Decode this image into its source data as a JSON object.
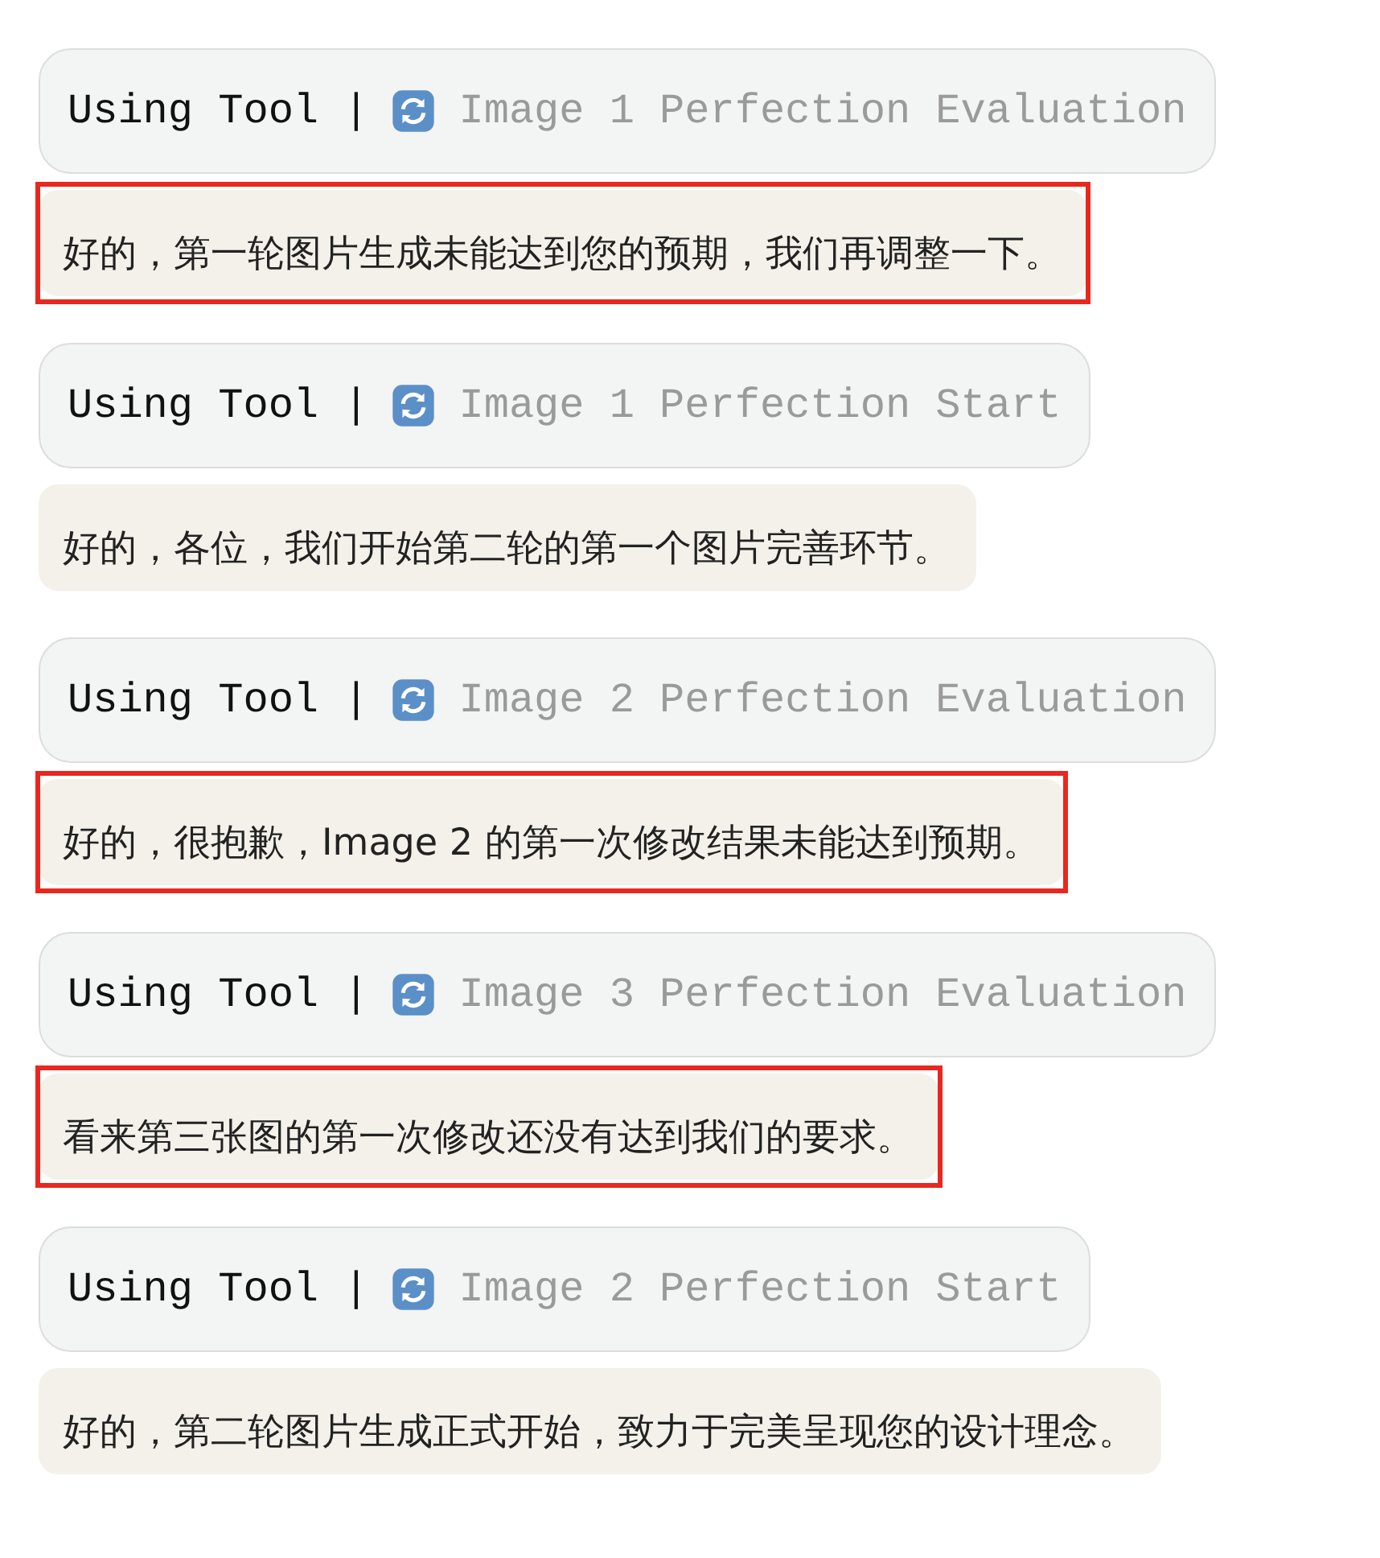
{
  "items": [
    {
      "kind": "tool",
      "prefix": "Using Tool |",
      "label": "Image 1 Perfection Evaluation"
    },
    {
      "kind": "message",
      "text": "好的，第一轮图片生成未能达到您的预期，我们再调整一下。",
      "highlighted": true
    },
    {
      "kind": "tool",
      "prefix": "Using Tool |",
      "label": "Image 1 Perfection Start"
    },
    {
      "kind": "message",
      "text": "好的，各位，我们开始第二轮的第一个图片完善环节。",
      "highlighted": false
    },
    {
      "kind": "tool",
      "prefix": "Using Tool |",
      "label": "Image 2 Perfection Evaluation"
    },
    {
      "kind": "message",
      "text": "好的，很抱歉，Image 2 的第一次修改结果未能达到预期。",
      "highlighted": true
    },
    {
      "kind": "tool",
      "prefix": "Using Tool |",
      "label": "Image 3 Perfection Evaluation"
    },
    {
      "kind": "message",
      "text": "看来第三张图的第一次修改还没有达到我们的要求。",
      "highlighted": true
    },
    {
      "kind": "tool",
      "prefix": "Using Tool |",
      "label": "Image 2 Perfection Start"
    },
    {
      "kind": "message",
      "text": "好的，第二轮图片生成正式开始，致力于完美呈现您的设计理念。",
      "highlighted": false
    }
  ]
}
